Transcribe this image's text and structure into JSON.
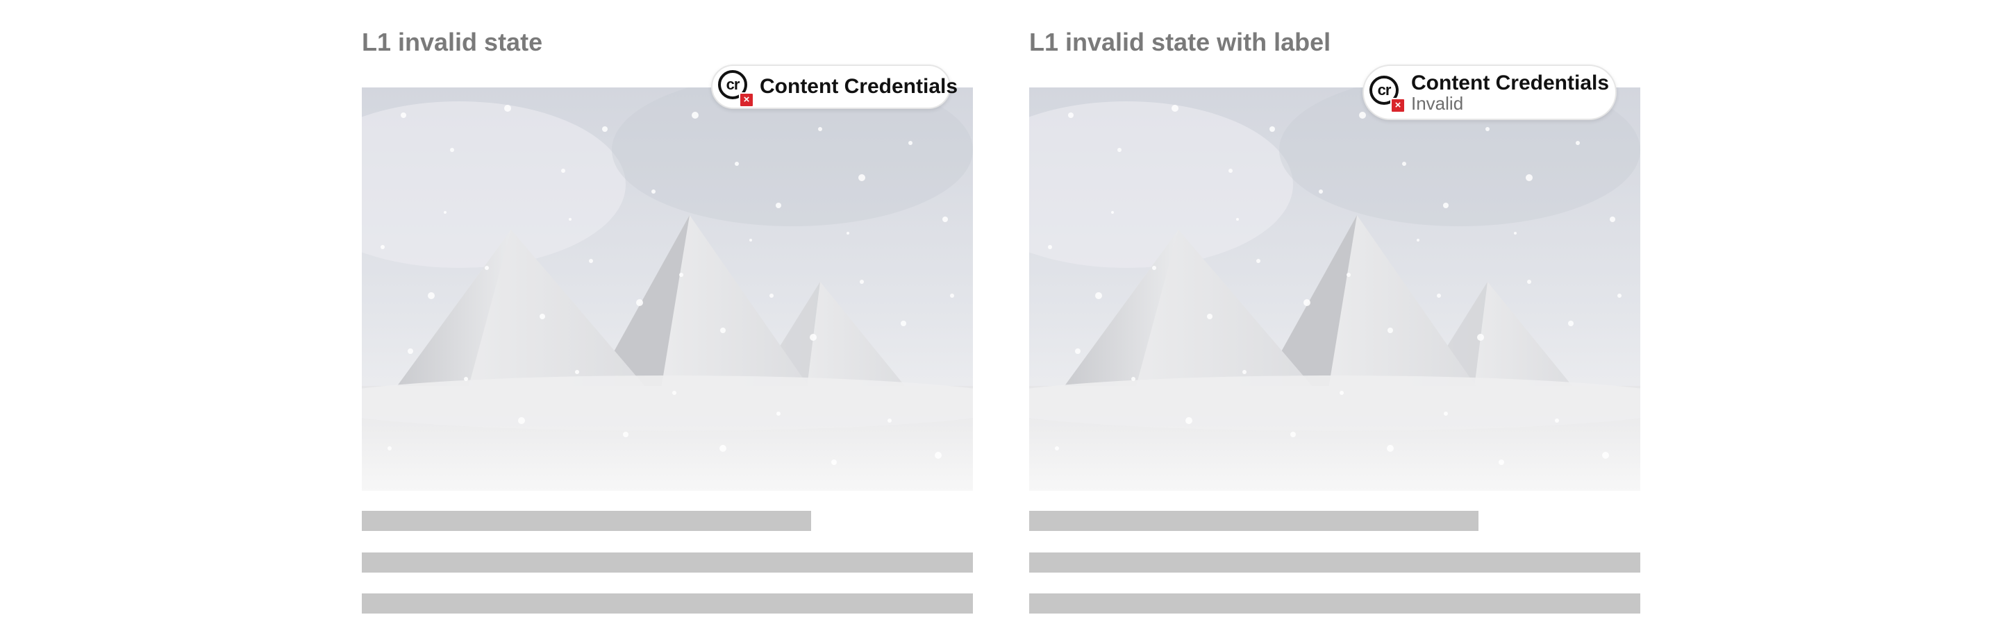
{
  "cards": [
    {
      "title": "L1 invalid state",
      "badge": {
        "label": "Content Credentials",
        "status": "",
        "icon": "cr-icon",
        "status_icon": "invalid-x-icon",
        "status_color": "#d9252b"
      },
      "image": {
        "subject": "snow-covered-pyramids"
      }
    },
    {
      "title": "L1 invalid state with label",
      "badge": {
        "label": "Content Credentials",
        "status": "Invalid",
        "icon": "cr-icon",
        "status_icon": "invalid-x-icon",
        "status_color": "#d9252b"
      },
      "image": {
        "subject": "snow-covered-pyramids"
      }
    }
  ],
  "icons": {
    "cr_glyph": "cr",
    "x_glyph": "×"
  },
  "colors": {
    "title": "#7a7a7a",
    "placeholder": "#c6c6c6",
    "invalid": "#d9252b"
  }
}
